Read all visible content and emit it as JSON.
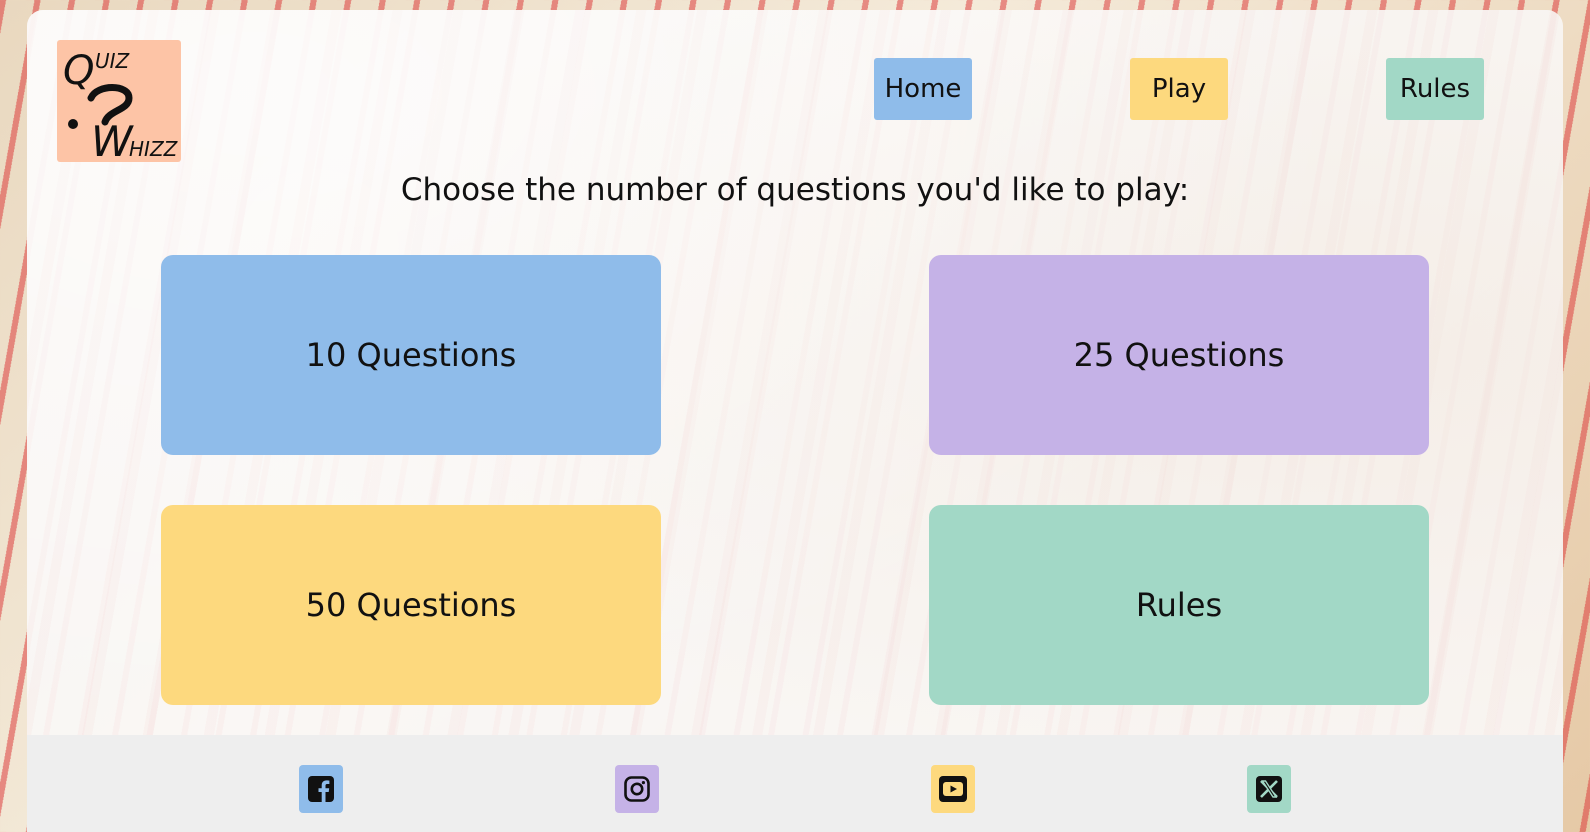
{
  "brand": {
    "logo_text_quiz": "QUIZ",
    "logo_text_whizz": "WHIZZ"
  },
  "nav": {
    "home": "Home",
    "play": "Play",
    "rules": "Rules"
  },
  "main": {
    "prompt": "Choose the number of questions you'd like to play:",
    "choices": [
      {
        "label": "10 Questions",
        "color": "#8fbcea"
      },
      {
        "label": "25 Questions",
        "color": "#c5b2e7"
      },
      {
        "label": "50 Questions",
        "color": "#fdd97e"
      },
      {
        "label": "Rules",
        "color": "#a2d8c6"
      }
    ]
  },
  "footer": {
    "social": [
      {
        "icon": "facebook-icon",
        "color": "#8fbcea"
      },
      {
        "icon": "instagram-icon",
        "color": "#c5b2e7"
      },
      {
        "icon": "youtube-icon",
        "color": "#fdd97e"
      },
      {
        "icon": "x-twitter-icon",
        "color": "#a2d8c6"
      }
    ]
  },
  "colors": {
    "blue": "#8fbcea",
    "yellow": "#fdd97e",
    "green": "#a2d8c6",
    "purple": "#c5b2e7",
    "peach": "#fdc4a6"
  }
}
